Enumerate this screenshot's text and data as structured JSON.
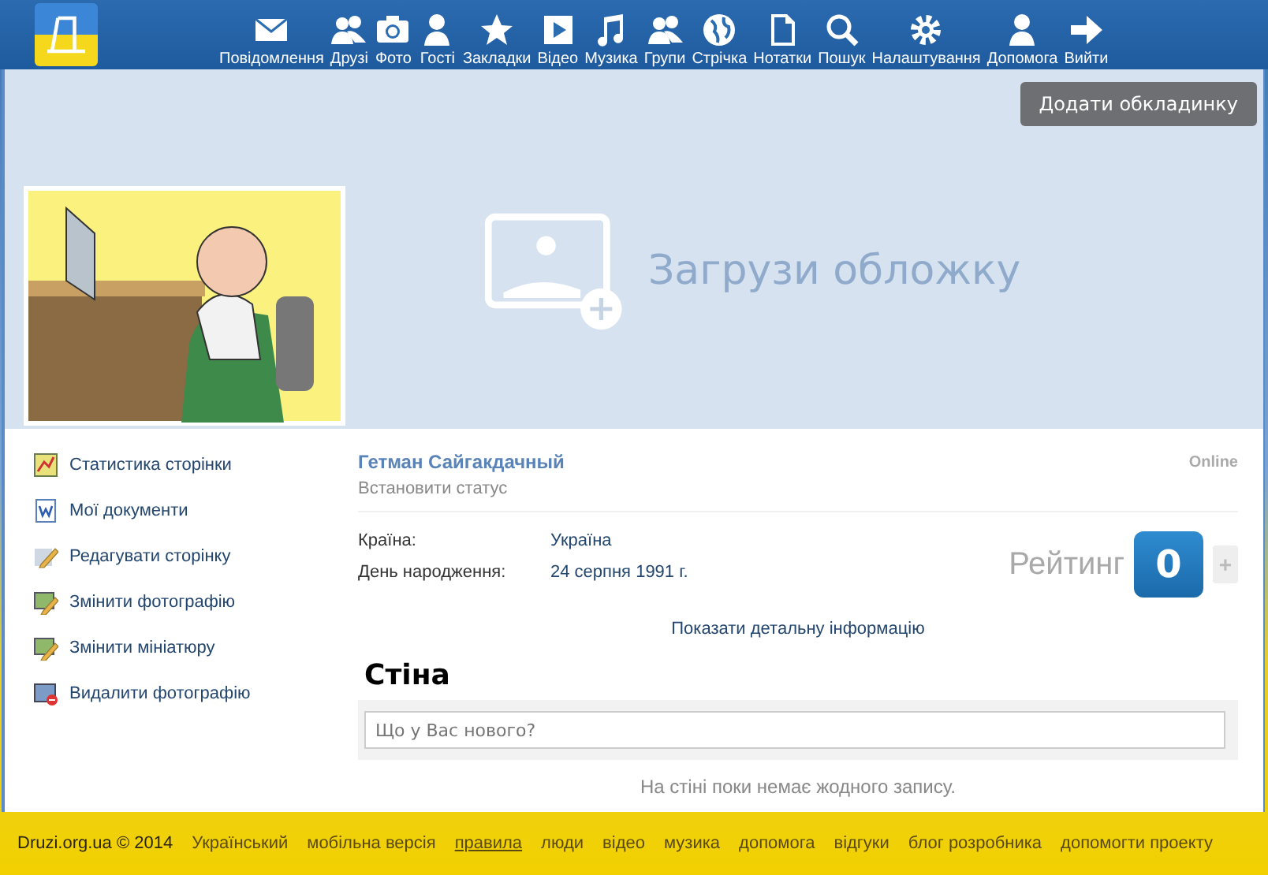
{
  "nav": [
    {
      "label": "Повідомлення"
    },
    {
      "label": "Друзі"
    },
    {
      "label": "Фото"
    },
    {
      "label": "Гості"
    },
    {
      "label": "Закладки"
    },
    {
      "label": "Відео"
    },
    {
      "label": "Музика"
    },
    {
      "label": "Групи"
    },
    {
      "label": "Стрічка"
    },
    {
      "label": "Нотатки"
    },
    {
      "label": "Пошук"
    },
    {
      "label": "Налаштування"
    },
    {
      "label": "Допомога"
    },
    {
      "label": "Вийти"
    }
  ],
  "cover": {
    "button": "Додати обкладинку",
    "upload_text": "Загрузи обложку"
  },
  "menu": [
    {
      "label": "Статистика сторінки"
    },
    {
      "label": "Мої документи"
    },
    {
      "label": "Редагувати сторінку"
    },
    {
      "label": "Змінити фотографію"
    },
    {
      "label": "Змінити мініатюру"
    },
    {
      "label": "Видалити фотографію"
    }
  ],
  "profile": {
    "name": "Гетман Сайгакдачный",
    "status": "Встановити статус",
    "presence": "Online",
    "info": [
      {
        "label": "Країна:",
        "value": "Україна"
      },
      {
        "label": "День народження:",
        "value": "24 серпня 1991 г."
      }
    ],
    "rating_label": "Рейтинг",
    "rating_value": "0",
    "rating_plus": "+",
    "details_link": "Показати детальну інформацію"
  },
  "wall": {
    "title": "Стіна",
    "placeholder": "Що у Вас нового?",
    "empty": "На стіні поки немає жодного запису."
  },
  "footer": [
    {
      "label": "Druzi.org.ua © 2014",
      "hovered": false
    },
    {
      "label": "Український",
      "hovered": false
    },
    {
      "label": "мобільна версія",
      "hovered": false
    },
    {
      "label": "правила",
      "hovered": true
    },
    {
      "label": "люди",
      "hovered": false
    },
    {
      "label": "відео",
      "hovered": false
    },
    {
      "label": "музика",
      "hovered": false
    },
    {
      "label": "допомога",
      "hovered": false
    },
    {
      "label": "відгуки",
      "hovered": false
    },
    {
      "label": "блог розробника",
      "hovered": false
    },
    {
      "label": "допомогти проекту",
      "hovered": false
    }
  ]
}
